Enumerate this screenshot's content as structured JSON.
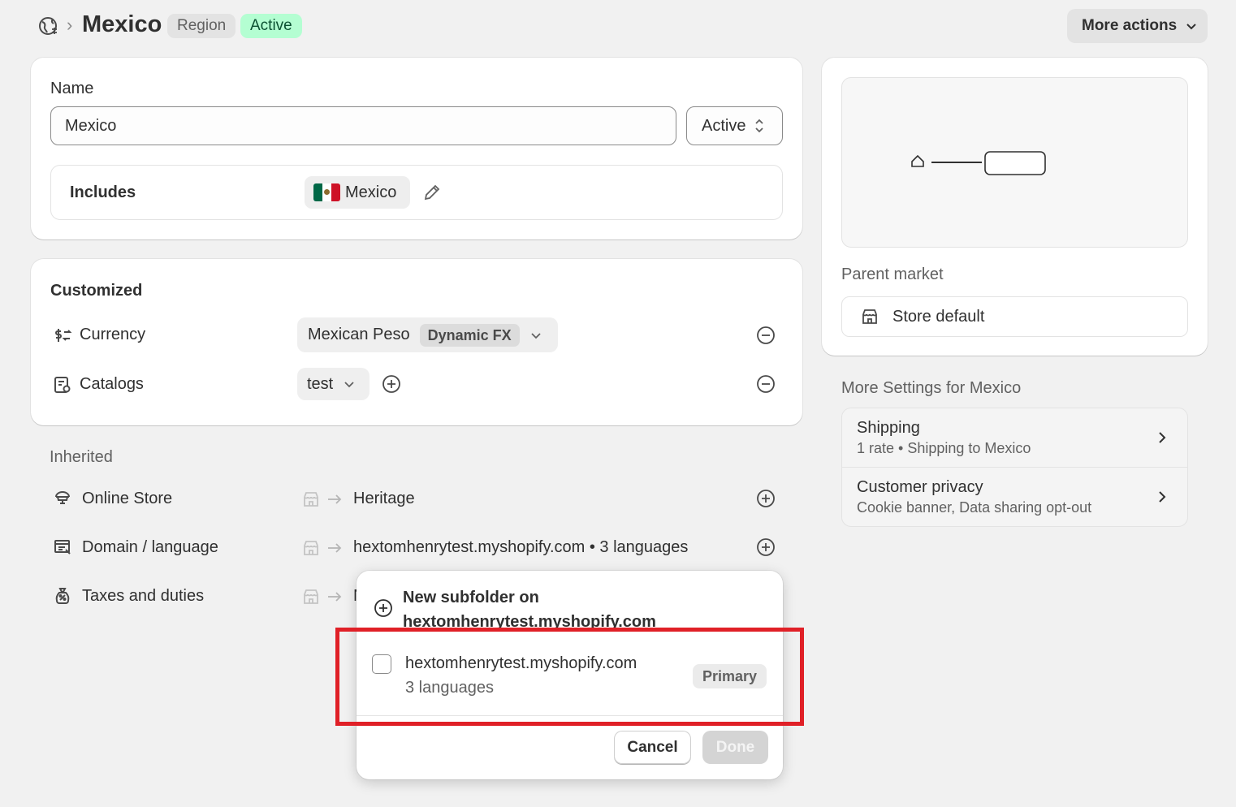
{
  "header": {
    "title": "Mexico",
    "badge_region": "Region",
    "badge_status": "Active",
    "more_actions": "More actions"
  },
  "region_card": {
    "name_label": "Name",
    "name_value": "Mexico",
    "status_value": "Active",
    "includes_label": "Includes",
    "includes_country": "Mexico"
  },
  "customized": {
    "title": "Customized",
    "currency_label": "Currency",
    "currency_value": "Mexican Peso",
    "currency_badge": "Dynamic FX",
    "catalogs_label": "Catalogs",
    "catalogs_value": "test"
  },
  "inherited": {
    "title": "Inherited",
    "rows": [
      {
        "label": "Online Store",
        "value": "Heritage"
      },
      {
        "label": "Domain / language",
        "value": "hextomhenrytest.myshopify.com • 3 languages"
      },
      {
        "label": "Taxes and duties",
        "value": "N"
      }
    ]
  },
  "sidebar": {
    "parent_market_label": "Parent market",
    "parent_market_value": "Store default",
    "more_settings_title": "More Settings for Mexico",
    "settings": [
      {
        "title": "Shipping",
        "subtitle": "1 rate • Shipping to Mexico"
      },
      {
        "title": "Customer privacy",
        "subtitle": "Cookie banner, Data sharing opt-out"
      }
    ]
  },
  "popover": {
    "new_subfolder_line1": "New subfolder on",
    "new_subfolder_line2": "hextomhenrytest.myshopify.com",
    "domain": "hextomhenrytest.myshopify.com",
    "languages": "3 languages",
    "primary_badge": "Primary",
    "cancel": "Cancel",
    "done": "Done"
  },
  "colors": {
    "active_badge_bg": "#b4fed2",
    "highlight": "#e02027",
    "flag_green": "#006847",
    "flag_red": "#ce1126"
  }
}
